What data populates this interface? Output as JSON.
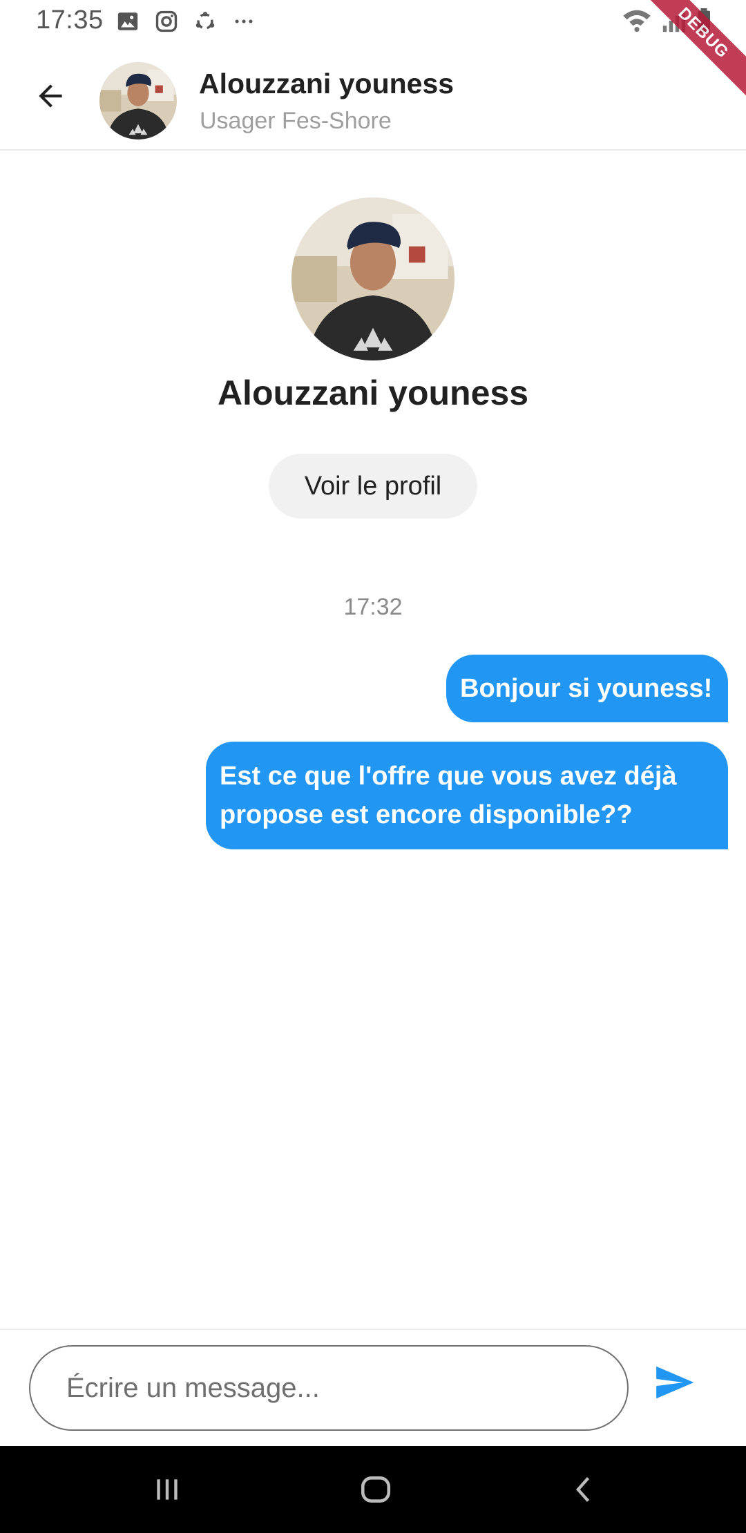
{
  "status_bar": {
    "time": "17:35",
    "icons": [
      "image-icon",
      "instagram-icon",
      "sync-icon",
      "more-icon"
    ],
    "right_icons": [
      "wifi-icon",
      "signal-icon",
      "battery-icon"
    ],
    "debug_label": "DEBUG"
  },
  "header": {
    "name": "Alouzzani youness",
    "subtitle": "Usager Fes-Shore"
  },
  "profile": {
    "name": "Alouzzani youness",
    "view_profile_label": "Voir le profil"
  },
  "conversation": {
    "timestamp": "17:32",
    "messages": [
      {
        "text": "Bonjour si youness!",
        "outgoing": true
      },
      {
        "text": "Est ce que l'offre que vous avez déjà propose est encore disponible??",
        "outgoing": true
      }
    ]
  },
  "composer": {
    "placeholder": "Écrire un message...",
    "value": ""
  },
  "colors": {
    "accent": "#2196f3",
    "bubble_text": "#ffffff",
    "debug_ribbon": "#b71c3a"
  }
}
